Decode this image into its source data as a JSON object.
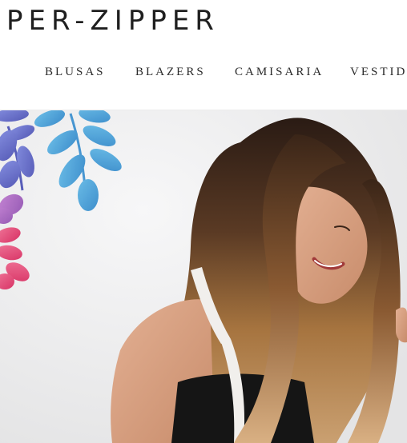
{
  "brand": {
    "logo_text": "PER-ZIPPER"
  },
  "nav": {
    "items": [
      {
        "label": "BLUSAS"
      },
      {
        "label": "BLAZERS"
      },
      {
        "label": "CAMISARIA"
      },
      {
        "label": "VESTIDO"
      }
    ]
  },
  "hero": {
    "image_subject": "woman-with-long-wavy-hair-smiling",
    "decoration": "watercolor-leaf-pattern",
    "colors": {
      "background": "#ececed",
      "leaf_blue": "#3a9ad8",
      "leaf_indigo": "#5a63c8",
      "leaf_pink": "#e5336a",
      "hair_dark": "#2e1f18",
      "hair_light": "#b07a4a",
      "skin": "#d9a383",
      "top": "#151515"
    }
  }
}
